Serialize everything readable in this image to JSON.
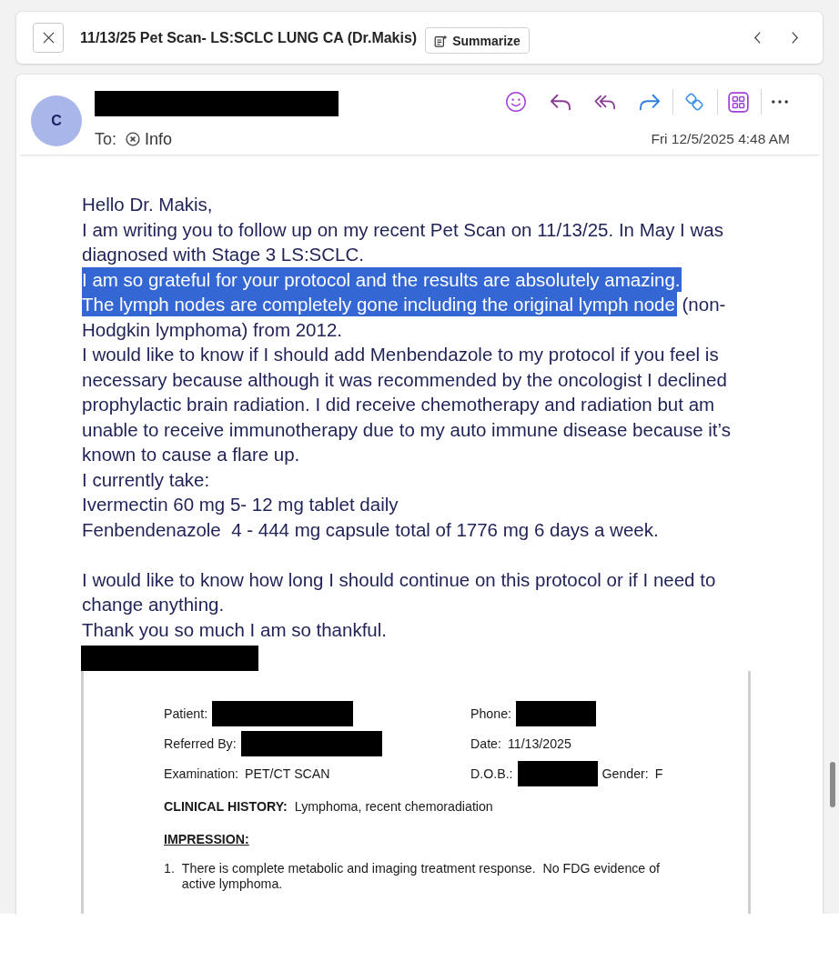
{
  "toolbar": {
    "subject": "11/13/25 Pet Scan- LS:SCLC LUNG CA (Dr.Makis)",
    "summarize_label": "Summarize"
  },
  "message": {
    "avatar_initial": "C",
    "sender": {
      "redacted": true
    },
    "to_label": "To:",
    "recipients": [
      {
        "name": "Info"
      }
    ],
    "date": "Fri 12/5/2025 4:48 AM"
  },
  "body": {
    "sections": [
      {
        "paragraphs": [
          {
            "runs": [
              {
                "text": "Hello Dr. Makis,",
                "selected": false
              }
            ]
          },
          {
            "runs": [
              {
                "text": "I am writing you to follow up on my recent Pet Scan on 11/13/25. In May I was diagnosed with Stage 3 LS:SCLC.",
                "selected": false
              }
            ]
          },
          {
            "runs": [
              {
                "text": "I am so grateful for your protocol and the results are absolutely amazing.",
                "selected": true
              }
            ]
          },
          {
            "runs": [
              {
                "text": "The lymph nodes are completely gone including the original lymph node",
                "selected": true
              },
              {
                "text": "(non-Hodgkin lymphoma) from 2012.",
                "selected": false
              }
            ]
          },
          {
            "runs": [
              {
                "text": "I would like to know if I should add Menbendazole to my protocol if you feel is necessary because although it was recommended by the oncologist I declined prophylactic brain radiation. I did receive chemotherapy and radiation but am unable to receive immunotherapy due to my auto immune disease because it’s known to cause a flare up.",
                "selected": false
              }
            ]
          },
          {
            "runs": [
              {
                "text": "I currently take:",
                "selected": false
              }
            ]
          },
          {
            "runs": [
              {
                "text": "Ivermectin 60 mg 5- 12 mg tablet daily",
                "selected": false
              }
            ]
          },
          {
            "runs": [
              {
                "text": "Fenbendenazole  4 - 444 mg capsule total of 1776 mg 6 days a week.",
                "selected": false
              }
            ]
          }
        ]
      },
      {
        "paragraphs": [
          {
            "runs": [
              {
                "text": "I would like to know how long I should continue on this protocol or if I need to change anything.",
                "selected": false
              }
            ]
          },
          {
            "runs": [
              {
                "text": "Thank you so much I am so thankful.",
                "selected": false
              }
            ]
          }
        ]
      }
    ],
    "signature": {
      "redacted": true
    }
  },
  "attachment": {
    "rows": [
      {
        "left": [
          {
            "label": "Patient:",
            "redacted": true
          }
        ],
        "right": [
          {
            "label": "Phone:",
            "redacted": true
          }
        ]
      },
      {
        "left": [
          {
            "label": "Referred By:",
            "redacted": true
          }
        ],
        "right": [
          {
            "label": "Date:",
            "value": "11/13/2025",
            "redacted": false
          }
        ]
      },
      {
        "left": [
          {
            "label": "Examination:",
            "value": "PET/CT SCAN",
            "redacted": false
          }
        ],
        "right": [
          {
            "label": "D.O.B.:",
            "redacted": true
          },
          {
            "label": "Gender:",
            "value": "F",
            "redacted": false
          }
        ]
      }
    ],
    "clinical_history": {
      "label": "CLINICAL HISTORY:",
      "text": "Lymphoma, recent chemoradiation"
    },
    "impression": {
      "heading": "IMPRESSION:",
      "items": [
        {
          "number": "1.",
          "text": "There is complete metabolic and imaging treatment response.  No FDG evidence of active lymphoma."
        }
      ]
    }
  }
}
